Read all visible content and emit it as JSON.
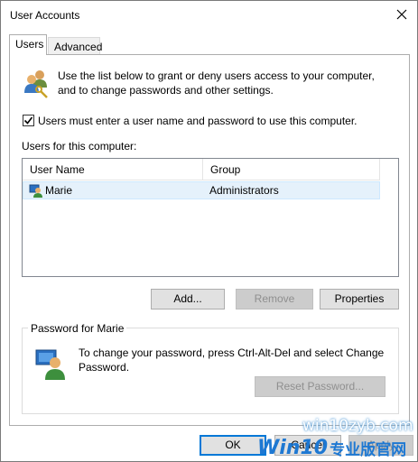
{
  "window": {
    "title": "User Accounts"
  },
  "tabs": [
    {
      "label": "Users",
      "active": true
    },
    {
      "label": "Advanced",
      "active": false
    }
  ],
  "users_tab": {
    "description": "Use the list below to grant or deny users access to your computer, and to change passwords and other settings.",
    "require_login": {
      "label": "Users must enter a user name and password to use this computer.",
      "checked": true
    },
    "list_heading": "Users for this computer:",
    "columns": [
      "User Name",
      "Group"
    ],
    "rows": [
      {
        "user": "Marie",
        "group": "Administrators",
        "selected": true
      }
    ],
    "buttons": {
      "add": "Add...",
      "remove": "Remove",
      "properties": "Properties"
    },
    "password_group": {
      "title": "Password for Marie",
      "text": "To change your password, press Ctrl-Alt-Del and select Change Password.",
      "reset_button": "Reset Password..."
    }
  },
  "footer_buttons": {
    "ok": "OK",
    "cancel": "Cancel",
    "apply": "Apply"
  },
  "watermark": {
    "url": "win10zyb.com",
    "brand": "Win10",
    "brand_suffix": "专业版官网"
  },
  "colors": {
    "accent": "#0078d7",
    "selection": "#e5f1fb",
    "watermark": "#1e78d2"
  }
}
